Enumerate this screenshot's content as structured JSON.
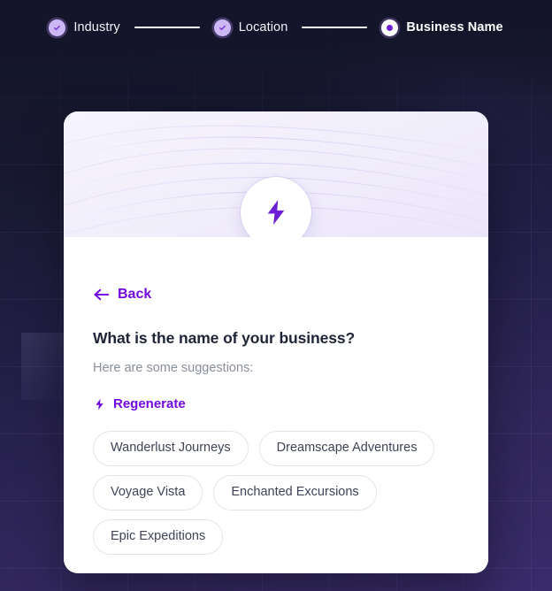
{
  "stepper": {
    "steps": [
      {
        "label": "Industry",
        "state": "done",
        "icon": "check-circle-icon"
      },
      {
        "label": "Location",
        "state": "done",
        "icon": "check-circle-icon"
      },
      {
        "label": "Business Name",
        "state": "active",
        "icon": "radio-filled-icon"
      }
    ]
  },
  "card": {
    "hero_icon": "lightning-bolt-icon",
    "back": {
      "label": "Back",
      "icon": "arrow-left-icon"
    },
    "question": "What is the name of your business?",
    "subtitle": "Here are some suggestions:",
    "regenerate": {
      "label": "Regenerate",
      "icon": "lightning-bolt-icon"
    },
    "suggestions": [
      "Wanderlust Journeys",
      "Dreamscape Adventures",
      "Voyage Vista",
      "Enchanted Excursions",
      "Epic Expeditions"
    ]
  },
  "colors": {
    "accent": "#7209e0",
    "step_done": "#cdb8f5",
    "card_background": "#ffffff",
    "hero_background": "#f2effc",
    "chip_border": "#e3e5eb",
    "chip_text": "#3f4456",
    "page_background_top": "#14152a",
    "page_background_bottom": "#392c6c"
  }
}
